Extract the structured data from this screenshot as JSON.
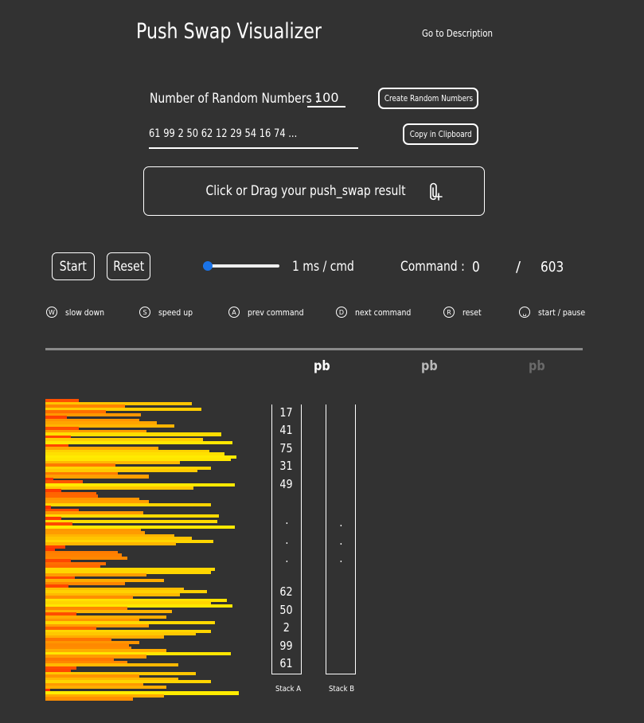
{
  "header": {
    "title": "Push Swap Visualizer",
    "description_link": "Go to Description"
  },
  "generator": {
    "count_label": "Number of Random Numbers :",
    "count_value": "100",
    "create_button": "Create Random Numbers",
    "numbers_preview": "61 99 2 50 62 12 29 54 16 74 ...",
    "copy_button": "Copy in Clipboard"
  },
  "upload": {
    "label": "Click or Drag your push_swap result",
    "icon": "paperclip-plus-icon"
  },
  "controls": {
    "start_button": "Start",
    "reset_button": "Reset",
    "speed_slider_level": 0,
    "speed_label": "1 ms / cmd",
    "command_label": "Command :",
    "command_current": "0",
    "command_separator": "/",
    "command_total": "603"
  },
  "shortcuts": [
    {
      "key": "W",
      "label": "slow down"
    },
    {
      "key": "S",
      "label": "speed up"
    },
    {
      "key": "A",
      "label": "prev command"
    },
    {
      "key": "D",
      "label": "next command"
    },
    {
      "key": "R",
      "label": "reset"
    },
    {
      "key": "␣",
      "label": "start / pause"
    }
  ],
  "operations": {
    "previous": "pb",
    "current": "pb",
    "next": "pb"
  },
  "stack_a": {
    "name": "Stack A",
    "top": [
      "17",
      "41",
      "75",
      "31",
      "49"
    ],
    "ellipsis": [
      ".",
      ".",
      "."
    ],
    "bottom": [
      "62",
      "50",
      "2",
      "99",
      "61"
    ]
  },
  "stack_b": {
    "name": "Stack B",
    "ellipsis": [
      ".",
      ".",
      "."
    ]
  },
  "visualization": {
    "max_value": 100,
    "colors": {
      "low": "#ff2a00",
      "mid": "#ff9900",
      "high": "#ffee00"
    },
    "values": [
      17,
      75,
      41,
      80,
      31,
      49,
      11,
      48,
      57,
      66,
      17,
      52,
      90,
      13,
      81,
      96,
      12,
      58,
      84,
      92,
      98,
      95,
      69,
      36,
      85,
      78,
      37,
      53,
      4,
      19,
      97,
      76,
      8,
      26,
      27,
      48,
      53,
      85,
      3,
      17,
      50,
      89,
      8,
      88,
      14,
      97,
      49,
      51,
      66,
      75,
      86,
      67,
      10,
      5,
      37,
      39,
      42,
      13,
      31,
      28,
      87,
      85,
      52,
      15,
      61,
      41,
      12,
      71,
      83,
      69,
      45,
      93,
      85,
      96,
      42,
      65,
      16,
      62,
      48,
      87,
      53,
      26,
      85,
      77,
      61,
      34,
      48,
      43,
      44,
      62,
      95,
      52,
      35,
      42,
      68,
      16,
      13,
      77,
      48,
      68,
      85,
      50,
      62,
      2,
      99,
      61,
      45
    ]
  }
}
